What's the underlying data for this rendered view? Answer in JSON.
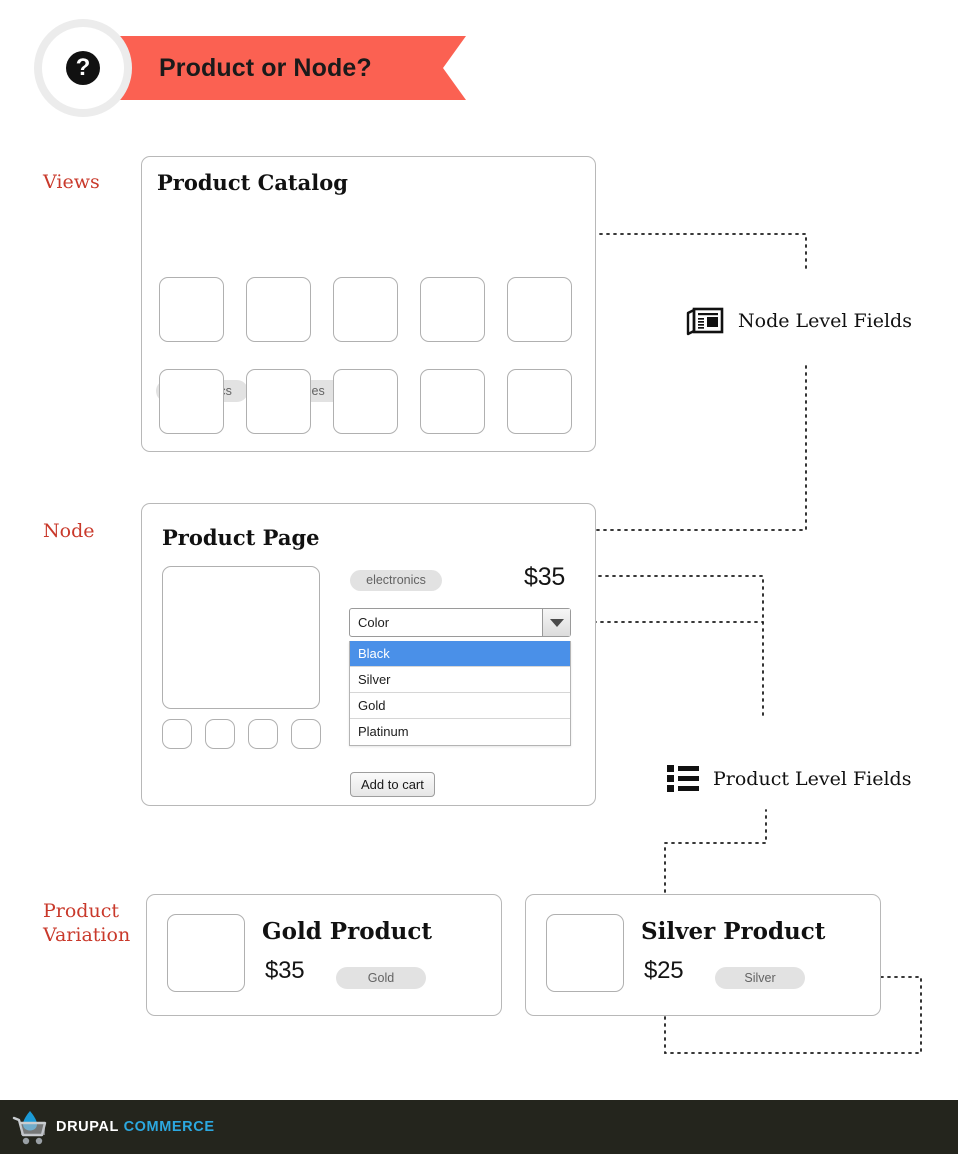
{
  "header": {
    "badge_icon": "question-mark-icon",
    "title": "Product or Node?",
    "ribbon_color": "#fb6152"
  },
  "row_labels": {
    "views": "Views",
    "node": "Node",
    "product_variation_line1": "Product",
    "product_variation_line2": "Variation",
    "color": "#c9392b"
  },
  "catalog": {
    "title": "Product Catalog",
    "tags": [
      "electronics",
      "games"
    ],
    "grid_rows": 2,
    "grid_cols": 5
  },
  "product_page": {
    "title": "Product Page",
    "tag": "electronics",
    "price": "$35",
    "select": {
      "label": "Color",
      "arrow_icon": "chevron-down-icon",
      "options": [
        "Black",
        "Silver",
        "Gold",
        "Platinum"
      ],
      "selected": "Black",
      "highlight_color": "#4a90e8"
    },
    "add_to_cart": "Add to cart",
    "thumbnail_count": 4
  },
  "legends": [
    {
      "icon": "newspaper-icon",
      "label": "Node Level Fields"
    },
    {
      "icon": "list-bullets-icon",
      "label": "Product Level Fields"
    }
  ],
  "variations": [
    {
      "title": "Gold Product",
      "price": "$35",
      "tag": "Gold"
    },
    {
      "title": "Silver Product",
      "price": "$25",
      "tag": "Silver"
    }
  ],
  "footer": {
    "logo_icon": "shopping-cart-icon",
    "brand_primary": "DRUPAL",
    "brand_secondary": "COMMERCE",
    "background": "#24251d",
    "accent": "#2ca8e0"
  }
}
